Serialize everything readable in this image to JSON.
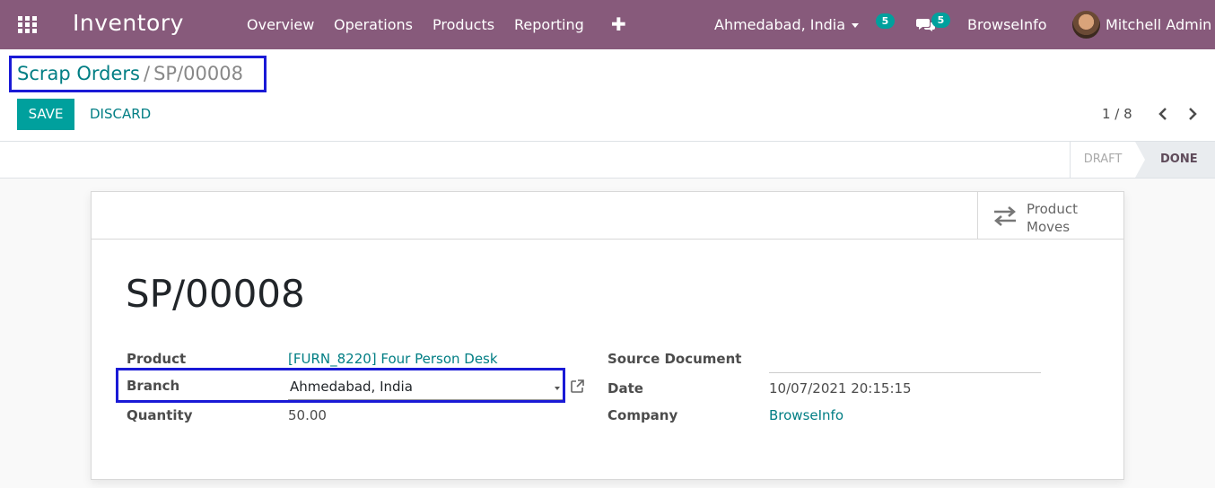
{
  "navbar": {
    "app_name": "Inventory",
    "menu": [
      "Overview",
      "Operations",
      "Products",
      "Reporting"
    ],
    "plus_label": "✚",
    "branch": "Ahmedabad, India",
    "activity_count": "5",
    "message_count": "5",
    "company": "BrowseInfo",
    "user": "Mitchell Admin",
    "bg_color": "#875a7b"
  },
  "breadcrumb": {
    "parent": "Scrap Orders",
    "separator": "/",
    "current": "SP/00008"
  },
  "toolbar": {
    "save_label": "SAVE",
    "discard_label": "DISCARD",
    "pager": "1 / 8"
  },
  "statusbar": {
    "draft": "DRAFT",
    "done": "DONE",
    "active": "DONE"
  },
  "smart_buttons": {
    "product_moves": "Product Moves"
  },
  "form": {
    "title": "SP/00008",
    "product_label": "Product",
    "product_value": "[FURN_8220] Four Person Desk",
    "branch_label": "Branch",
    "branch_value": "Ahmedabad, India",
    "quantity_label": "Quantity",
    "quantity_value": "50.00",
    "source_document_label": "Source Document",
    "source_document_value": "",
    "date_label": "Date",
    "date_value": "10/07/2021 20:15:15",
    "company_label": "Company",
    "company_value": "BrowseInfo"
  },
  "colors": {
    "accent": "#00a09d",
    "link": "#017e84",
    "highlight_box": "#1a1ad6"
  }
}
